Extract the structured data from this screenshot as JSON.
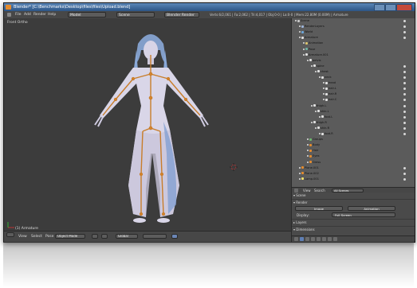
{
  "window": {
    "title": "Blender* [C:\\Benchmarks\\Desktop\\files\\files\\Upload.blend]",
    "controls": [
      "minimize",
      "maximize",
      "close"
    ]
  },
  "menubar": {
    "items": [
      "File",
      "Add",
      "Render",
      "Help"
    ],
    "layout_field": "Model",
    "scene_field": "Scene",
    "render_engine": "Blender Render",
    "stats": "Verts:6/2,061 | Fa:2,062 | Tri:4,017 | Obj:0-0 | La:0-0 | Mem:22.80M (0.00M) | Armature"
  },
  "viewport": {
    "label": "Front Ortho",
    "object_label": "(1) Armature"
  },
  "viewport_header": {
    "view": "View",
    "select": "Select",
    "pose": "Pose",
    "mode": "Object Mode",
    "pivot": "Global"
  },
  "outliner": {
    "rows": [
      {
        "label": "Scene",
        "depth": 0,
        "icon": "scene-icon"
      },
      {
        "label": "RenderLayers",
        "depth": 1,
        "icon": "layers-icon"
      },
      {
        "label": "World",
        "depth": 1,
        "icon": "world-icon"
      },
      {
        "label": "Armature",
        "depth": 1,
        "icon": "armature-icon"
      },
      {
        "label": "Animation",
        "depth": 2,
        "icon": "anim-icon"
      },
      {
        "label": "Pose",
        "depth": 2,
        "icon": "pose-icon"
      },
      {
        "label": "Armature.001",
        "depth": 2,
        "icon": "armature-icon"
      },
      {
        "label": "pelvis",
        "depth": 3,
        "icon": "bone-icon"
      },
      {
        "label": "spine",
        "depth": 4,
        "icon": "bone-icon"
      },
      {
        "label": "chest",
        "depth": 5,
        "icon": "bone-icon"
      },
      {
        "label": "neck",
        "depth": 6,
        "icon": "bone-icon"
      },
      {
        "label": "head",
        "depth": 7,
        "icon": "bone-icon"
      },
      {
        "label": "hair.L",
        "depth": 7,
        "icon": "bone-icon"
      },
      {
        "label": "hair.R",
        "depth": 7,
        "icon": "bone-icon"
      },
      {
        "label": "hair.C",
        "depth": 7,
        "icon": "bone-icon"
      },
      {
        "label": "thigh.L",
        "depth": 4,
        "icon": "bone-icon"
      },
      {
        "label": "shin.L",
        "depth": 5,
        "icon": "bone-icon"
      },
      {
        "label": "foot.L",
        "depth": 6,
        "icon": "bone-icon"
      },
      {
        "label": "thigh.R",
        "depth": 4,
        "icon": "bone-icon"
      },
      {
        "label": "shin.R",
        "depth": 5,
        "icon": "bone-icon"
      },
      {
        "label": "foot.R",
        "depth": 6,
        "icon": "bone-icon"
      },
      {
        "label": "Groups",
        "depth": 3,
        "icon": "group-icon"
      },
      {
        "label": "Body",
        "depth": 3,
        "icon": "mesh-icon"
      },
      {
        "label": "Hair",
        "depth": 3,
        "icon": "mesh-icon"
      },
      {
        "label": "Eyes",
        "depth": 3,
        "icon": "mesh-icon"
      },
      {
        "label": "Dress",
        "depth": 3,
        "icon": "mesh-icon"
      },
      {
        "label": "Plane.001",
        "depth": 1,
        "icon": "mesh-icon"
      },
      {
        "label": "Plane.002",
        "depth": 1,
        "icon": "mesh-icon"
      },
      {
        "label": "Lamp.001",
        "depth": 1,
        "icon": "lamp-icon"
      }
    ]
  },
  "outliner_header": {
    "view": "View",
    "search": "Search",
    "filter": "All Scenes"
  },
  "properties": {
    "scene_panel": "Scene",
    "scene_sub": "Scene",
    "render_panel": "Render",
    "image_btn": "Image",
    "animation_btn": "Animation",
    "display_label": "Display:",
    "display_value": "Full Screen",
    "layers_panel": "Layers",
    "dimensions_panel": "Dimensions"
  },
  "colors": {
    "accent": "#e58b2c",
    "titlebar_top": "#5a86b8",
    "outliner_bg": "#5b5b5b"
  }
}
